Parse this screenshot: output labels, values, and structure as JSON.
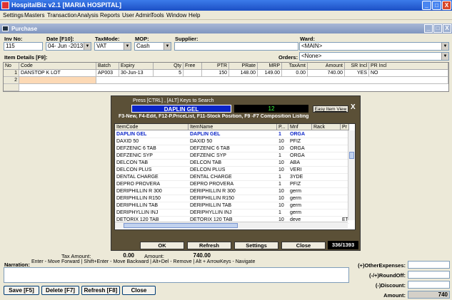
{
  "window": {
    "title": "HospitalBiz v2.1 [MARIA HOSPITAL]",
    "min": "_",
    "max": "□",
    "close": "X"
  },
  "menu": [
    "Settings",
    "Masters",
    "Transaction",
    "Analysis",
    "Reports",
    "User Admin",
    "Tools",
    "Window",
    "Help"
  ],
  "child": {
    "title": "Purchase",
    "min": "_",
    "max": "□",
    "close": "X"
  },
  "form": {
    "inv_label": "Inv No:",
    "inv_value": "115",
    "date_label": "Date [F10]:",
    "date_value": "04- Jun -2013",
    "tax_label": "TaxMode:",
    "tax_value": "VAT",
    "mop_label": "MOP:",
    "mop_value": "Cash",
    "supplier_label": "Supplier:",
    "supplier_value": "",
    "ward_label": "Ward:",
    "ward_value": "<MAIN>",
    "orders_label": "Orders:",
    "orders_value": "<None>",
    "items_label": "Item Details [F9]:"
  },
  "grid": {
    "headers": [
      "No",
      "Code",
      "Batch",
      "Expiry",
      "Qty",
      "Free",
      "PTR",
      "PRate",
      "MRP",
      "TaxAmt",
      "Amount",
      "SR Incl",
      "PR Incl"
    ],
    "rows": [
      [
        "1",
        "DANSTOP K LOT",
        "AP003",
        "30-Jun-13",
        "5",
        "",
        "150",
        "148.00",
        "149.00",
        "0.00",
        "740.00",
        "YES",
        "NO"
      ],
      [
        "2",
        "",
        "",
        "",
        "",
        "",
        "",
        "",
        "",
        "",
        "",
        "",
        ""
      ]
    ]
  },
  "popup": {
    "hint": "Press [CTRL] , [ALT] Keys to Search",
    "search_value": "DAPLIN GEL",
    "count_value": "12",
    "view_button": "Easy Item View",
    "close": "X",
    "shortcuts": "F3-New, F4-Edit, F12-P.PriceList, F11-Stock Position, F9 -F7 Composition Listing",
    "headers": [
      "ItemCode",
      "ItemName",
      "P...",
      "Mnf",
      "Rack",
      "Pr"
    ],
    "rows": [
      [
        "DAPLIN GEL",
        "DAPLIN GEL",
        "1",
        "ORGA",
        "",
        ""
      ],
      [
        "DAXID 50",
        "DAXID 50",
        "10",
        "PFIZ",
        "",
        ""
      ],
      [
        "DEFZENIC 6 TAB",
        "DEFZENIC 6 TAB",
        "10",
        "ORGA",
        "",
        ""
      ],
      [
        "DEFZENIC SYP",
        "DEFZENIC SYP",
        "1",
        "ORGA",
        "",
        ""
      ],
      [
        "DELCON  TAB",
        "DELCON  TAB",
        "10",
        "ABA",
        "",
        ""
      ],
      [
        "DELCON PLUS",
        "DELCON PLUS",
        "10",
        "VERI",
        "",
        ""
      ],
      [
        "DENTAL CHARGE",
        "DENTAL CHARGE",
        "1",
        "3YDE",
        "",
        ""
      ],
      [
        "DEPRO PROVERA",
        "DEPRO PROVERA",
        "1",
        "PFIZ",
        "",
        ""
      ],
      [
        "DERIPHILLIN R 300",
        "DERIPHILLIN R 300",
        "10",
        "germ",
        "",
        ""
      ],
      [
        "DERIPHILLIN R150",
        "DERIPHILLIN R150",
        "10",
        "germ",
        "",
        ""
      ],
      [
        "DERIPHILLIN TAB",
        "DERIPHILLIN TAB",
        "10",
        "germ",
        "",
        ""
      ],
      [
        "DERIPHYLLIN INJ",
        "DERIPHYLLIN INJ",
        "1",
        "germ",
        "",
        ""
      ],
      [
        "DETORIX 120 TAB",
        "DETORIX 120 TAB",
        "10",
        "deve",
        "",
        "ET"
      ]
    ],
    "ok": "OK",
    "refresh": "Refresh",
    "settings": "Settings",
    "close_btn": "Close",
    "counter": "336/1393"
  },
  "footer": {
    "tax_label": "Tax Amount:",
    "tax_value": "0.00",
    "amount_label": "Amount:",
    "amount_value": "740.00",
    "narration_label": "Narration:",
    "hint": "Enter - Move Forward | Shift+Enter - Move Backward | Alt+Del - Remove | Alt + ArrowKeys - Navigate",
    "other_label": "(+)OtherExpenses:",
    "round_label": "(-/+)RoundOff:",
    "discount_label": "(-)Discount:",
    "total_label": "Amount:",
    "total_value": "740",
    "save": "Save [F5]",
    "delete": "Delete [F7]",
    "refresh": "Refresh [F8]",
    "close": "Close"
  },
  "colors": {
    "title_blue": "#1c4fc4",
    "popup_frame": "#5b5037",
    "highlight_blue": "#0a24c8",
    "search_bg": "#0a24c8",
    "counter_green": "#3dff3d"
  }
}
